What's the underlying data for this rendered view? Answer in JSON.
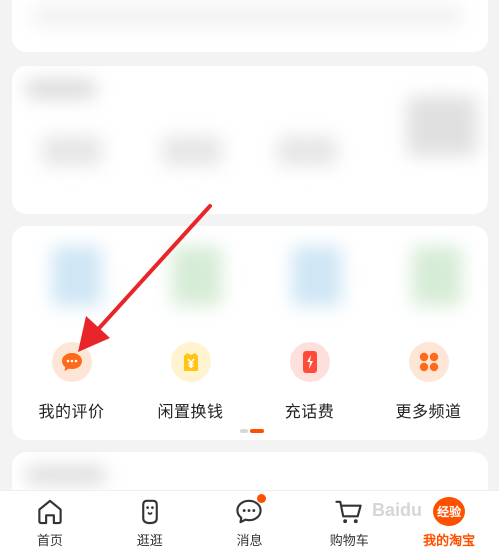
{
  "tools": [
    {
      "label": "我的评价",
      "icon": "chat-bubble-icon",
      "color": "#ff6a1a",
      "bg": "#fde6d6"
    },
    {
      "label": "闲置换钱",
      "icon": "yuan-bag-icon",
      "color": "#ffc414",
      "bg": "#fff4cf"
    },
    {
      "label": "充话费",
      "icon": "phone-charge-icon",
      "color": "#ff4b3a",
      "bg": "#fde0db"
    },
    {
      "label": "更多频道",
      "icon": "grid-dots-icon",
      "color": "#ff6a1a",
      "bg": "#fde6d6"
    }
  ],
  "tabbar": [
    {
      "label": "首页",
      "icon": "home-icon"
    },
    {
      "label": "逛逛",
      "icon": "guangguang-icon"
    },
    {
      "label": "消息",
      "icon": "message-icon",
      "has_badge": true
    },
    {
      "label": "购物车",
      "icon": "cart-icon"
    },
    {
      "label": "我的淘宝",
      "icon": "avatar-icon",
      "active": true,
      "bubble_text": "经验"
    }
  ],
  "watermark": "Baidu",
  "colors": {
    "accent": "#ff5000",
    "arrow": "#e8262a"
  }
}
